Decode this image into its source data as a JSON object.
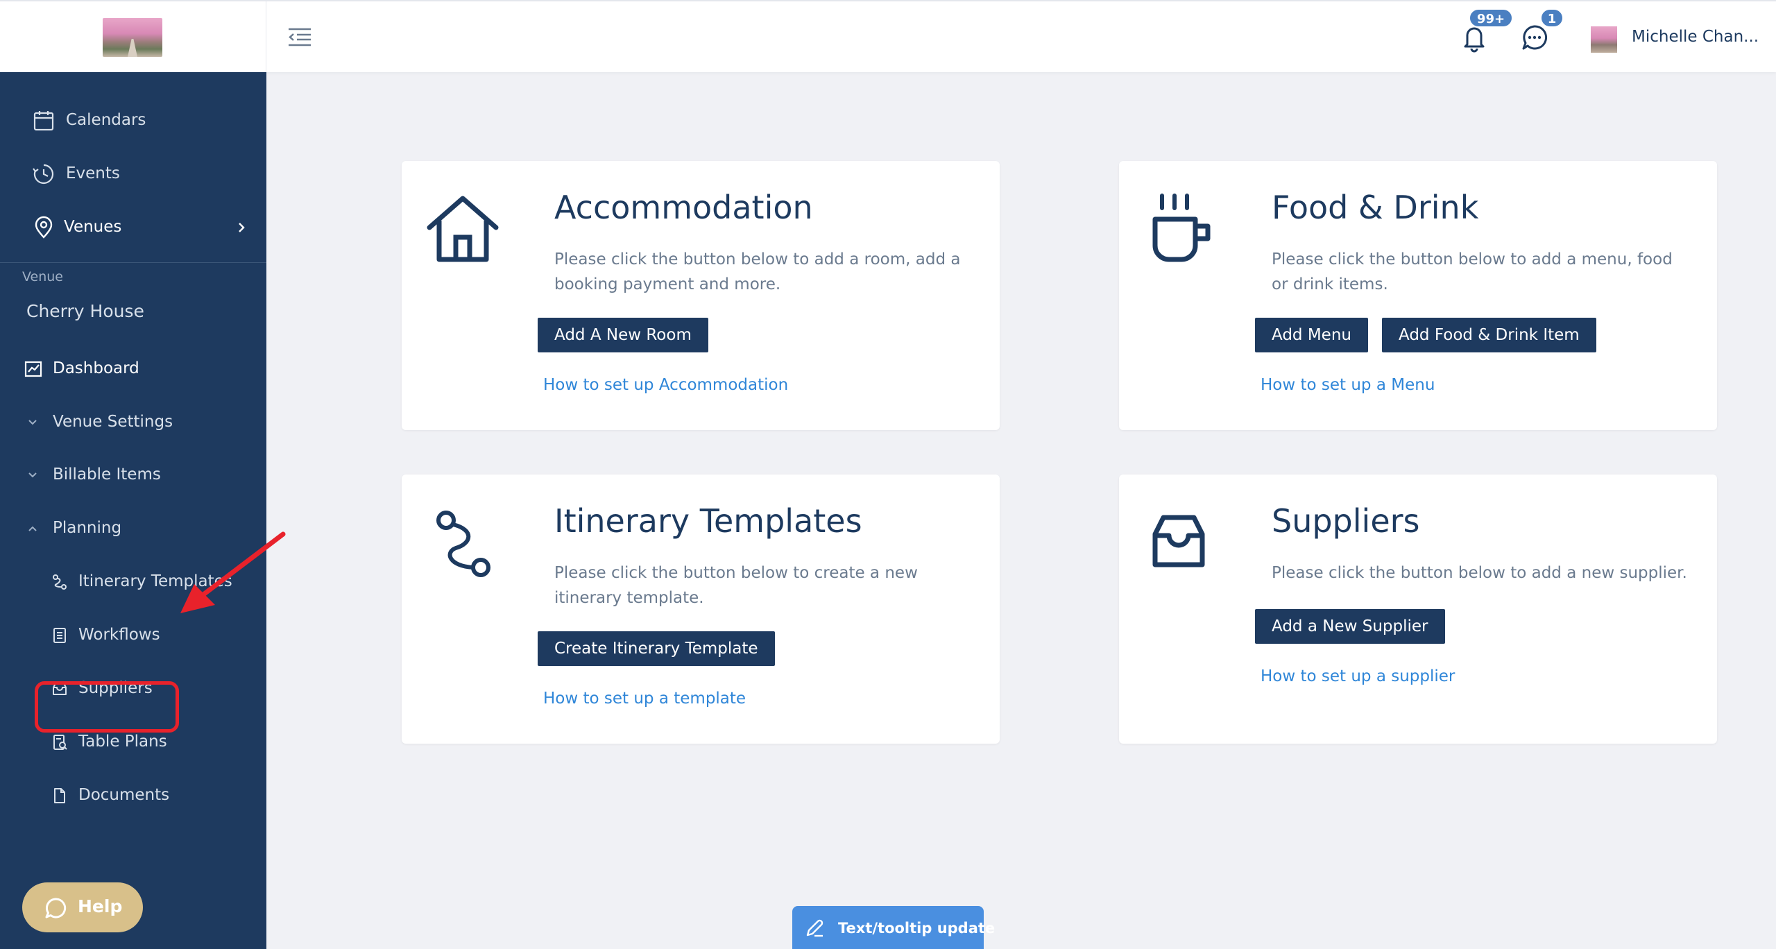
{
  "header": {
    "user_name": "Michelle Chan...",
    "notifications_badge": "99+",
    "messages_badge": "1"
  },
  "sidebar": {
    "top_items": [
      {
        "label": "Calendars",
        "icon": "calendar-icon"
      },
      {
        "label": "Events",
        "icon": "clock-icon"
      },
      {
        "label": "Venues",
        "icon": "location-pin-icon"
      }
    ],
    "section_label": "Venue",
    "venue_name": "Cherry House",
    "items": [
      {
        "label": "Dashboard",
        "icon": "chart-icon"
      },
      {
        "label": "Venue Settings",
        "icon": "chevron-down-icon"
      },
      {
        "label": "Billable Items",
        "icon": "chevron-down-icon"
      },
      {
        "label": "Planning",
        "icon": "chevron-up-icon"
      },
      {
        "label": "Itinerary Templates",
        "icon": "route-icon"
      },
      {
        "label": "Workflows",
        "icon": "document-list-icon"
      },
      {
        "label": "Suppliers",
        "icon": "inbox-icon"
      },
      {
        "label": "Table Plans",
        "icon": "table-plan-icon"
      },
      {
        "label": "Documents",
        "icon": "file-icon"
      }
    ],
    "help_label": "Help"
  },
  "cards": {
    "accommodation": {
      "title": "Accommodation",
      "description": "Please click the button below to add a room, add a booking payment and more.",
      "button": "Add A New Room",
      "link": "How to set up Accommodation"
    },
    "food_drink": {
      "title": "Food & Drink",
      "description": "Please click the button below to add a menu, food or drink items.",
      "button_1": "Add Menu",
      "button_2": "Add Food & Drink Item",
      "link": "How to set up a Menu"
    },
    "itinerary": {
      "title": "Itinerary Templates",
      "description": "Please click the button below to create a new itinerary template.",
      "button": "Create Itinerary Template",
      "link": "How to set up a template"
    },
    "suppliers": {
      "title": "Suppliers",
      "description": "Please click the button below to add a new supplier.",
      "button": "Add a New Supplier",
      "link": "How to set up a supplier"
    }
  },
  "tooltip_update": "Text/tooltip update",
  "colors": {
    "sidebar_bg": "#1e3a5f",
    "primary_button": "#1e3a5f",
    "link": "#2f86d8",
    "help_button": "#d8c08a",
    "highlight": "#e8222b"
  }
}
